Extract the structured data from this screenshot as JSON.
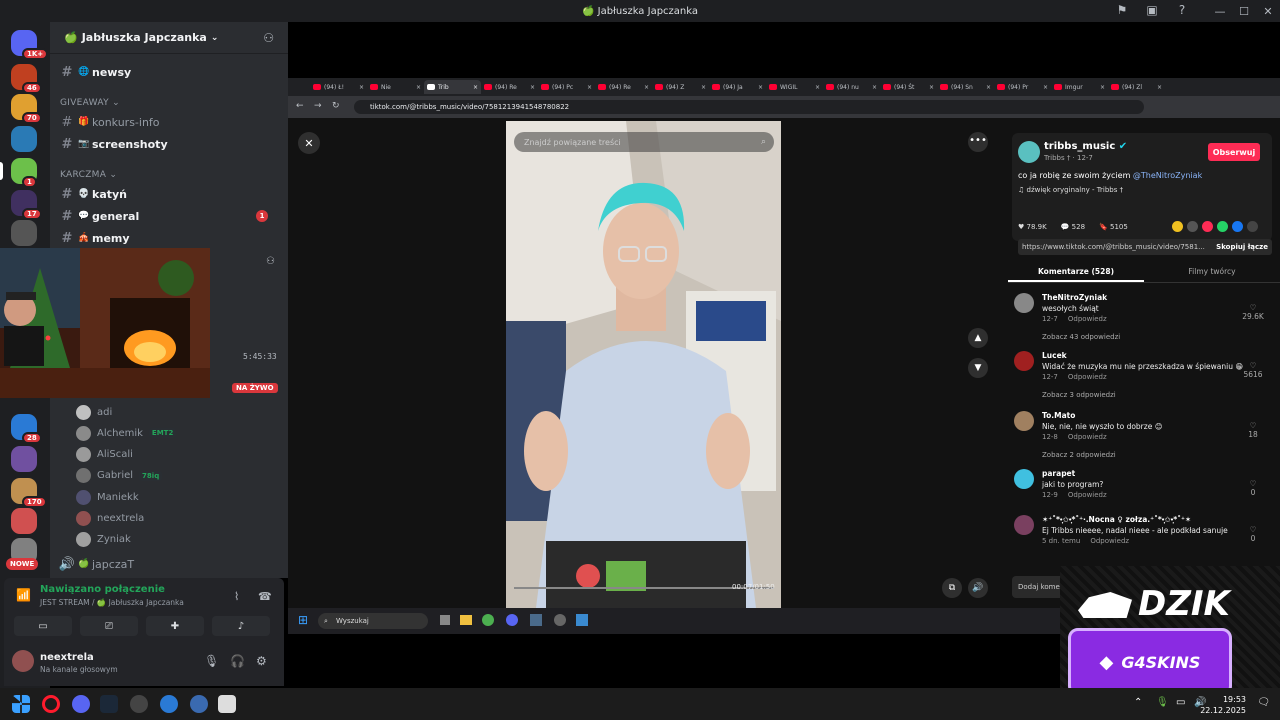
{
  "window": {
    "title": "🍏 Jabłuszka Japczanka"
  },
  "server": {
    "name": "Jabłuszka Japczanka"
  },
  "server_rail": [
    {
      "badge": "1K+",
      "color": "#5865f2"
    },
    {
      "badge": "46",
      "color": "#c04020"
    },
    {
      "badge": "70",
      "color": "#e0a030"
    },
    {
      "badge": "",
      "color": "#2a7ab5"
    },
    {
      "badge": "1",
      "color": "#6cc04a"
    },
    {
      "badge": "17",
      "color": "#403060"
    },
    {
      "badge": "",
      "color": "#555555"
    },
    {
      "badge": "28",
      "color": "#2a7ad5"
    },
    {
      "badge": "",
      "color": "#7050a0"
    },
    {
      "badge": "170",
      "color": "#c09050"
    },
    {
      "badge": "",
      "color": "#d05050"
    },
    {
      "badge": "",
      "color": "#808080"
    }
  ],
  "rail_new_badge": "NOWE",
  "categories": {
    "giveaway": "GIVEAWAY",
    "karczma": "KARCZMA"
  },
  "channels": {
    "newsy": "newsy",
    "konkurs": "konkurs-info",
    "screenshoty": "screenshoty",
    "katyn": "katyń",
    "general": "general",
    "general_mentions": "1",
    "memy": "memy",
    "voice_channel": "japczaT"
  },
  "stream": {
    "timer": "5:45:33",
    "live_label": "NA ŻYWO"
  },
  "voice_users": [
    {
      "name": "adi",
      "tag": "",
      "color": "#c0c0c0"
    },
    {
      "name": "Alchemik",
      "tag": "EMT2",
      "color": "#8a8a8a"
    },
    {
      "name": "AliScali",
      "tag": "",
      "color": "#9a9a9a"
    },
    {
      "name": "Gabriel",
      "tag": "78iq",
      "color": "#707070"
    },
    {
      "name": "Maniekk",
      "tag": "",
      "color": "#505070"
    },
    {
      "name": "neextrela",
      "tag": "",
      "color": "#905050"
    },
    {
      "name": "Zyniak",
      "tag": "",
      "color": "#a0a0a0"
    }
  ],
  "voice_panel": {
    "status": "Nawiązano połączenie",
    "sub": "JEST STREAM / 🍏 Jabłuszka Japczanka"
  },
  "user_panel": {
    "name": "neextrela",
    "status": "Na kanale głosowym"
  },
  "browser": {
    "url": "tiktok.com/@tribbs_music/video/7581213941548780822",
    "tabs": [
      "(94) Ł!",
      "Nie",
      "Trib",
      "(94) Re",
      "(94) Pc",
      "(94) Re",
      "(94) Z",
      "(94) Ja",
      "WIGIL",
      "(94) nu",
      "(94) Śt",
      "(94) Sn",
      "(94) Pr",
      "Imgur",
      "(94) Zl"
    ]
  },
  "tiktok": {
    "search_placeholder": "Znajdź powiązane treści",
    "creator": "tribbs_music",
    "creator_sub": "Tribbs † · 12-7",
    "follow": "Obserwuj",
    "description": "co ja robię ze swoim życiem",
    "mention": "@TheNitroZyniak",
    "sound": "♫  dźwięk oryginalny - Tribbs †",
    "likes": "78.9K",
    "comments_count": "528",
    "saves": "5105",
    "link": "https://www.tiktok.com/@tribbs_music/video/7581...",
    "copy_link": "Skopiuj łącze",
    "tab_comments": "Komentarze (528)",
    "tab_creator": "Filmy twórcy",
    "add_comment": "Dodaj kome",
    "video_time": "00:07/01:50"
  },
  "comments": [
    {
      "name": "TheNitroZyniak",
      "text": "wesołych świąt",
      "date": "12-7",
      "reply": "Odpowiedz",
      "more": "Zobacz 43 odpowiedzi",
      "likes": "29.6K",
      "color": "#888888"
    },
    {
      "name": "Lucek",
      "text": "Widać że muzyka mu nie przeszkadza w śpiewaniu 😁",
      "date": "12-7",
      "reply": "Odpowiedz",
      "more": "Zobacz 3 odpowiedzi",
      "likes": "5616",
      "color": "#a02020"
    },
    {
      "name": "To.Mato",
      "text": "Nie, nie, nie wyszło to dobrze 😊",
      "date": "12-8",
      "reply": "Odpowiedz",
      "more": "Zobacz 2 odpowiedzi",
      "likes": "18",
      "color": "#a08060"
    },
    {
      "name": "parapet",
      "text": "jaki to program?",
      "date": "12-9",
      "reply": "Odpowiedz",
      "more": "",
      "likes": "0",
      "color": "#40c0e0"
    },
    {
      "name": "✶⁺˚*•̩̩͙✩•̩̩͙*˚⁺‧.Nocna ♀ zołza.⁺˚*•̩̩͙✩•̩̩͙*˚⁺✶",
      "text": "Ej Tribbs nieeee, nadal nieee - ale podkład sanuje",
      "date": "5 dn. temu",
      "reply": "Odpowiedz",
      "more": "",
      "likes": "0",
      "color": "#7a4060"
    }
  ],
  "inner_taskbar": {
    "search": "Wyszukaj"
  },
  "overlay": {
    "brand": "DZIK",
    "sponsor": "G4SKINS"
  },
  "clock": {
    "time": "19:53",
    "date": "22.12.2025"
  }
}
